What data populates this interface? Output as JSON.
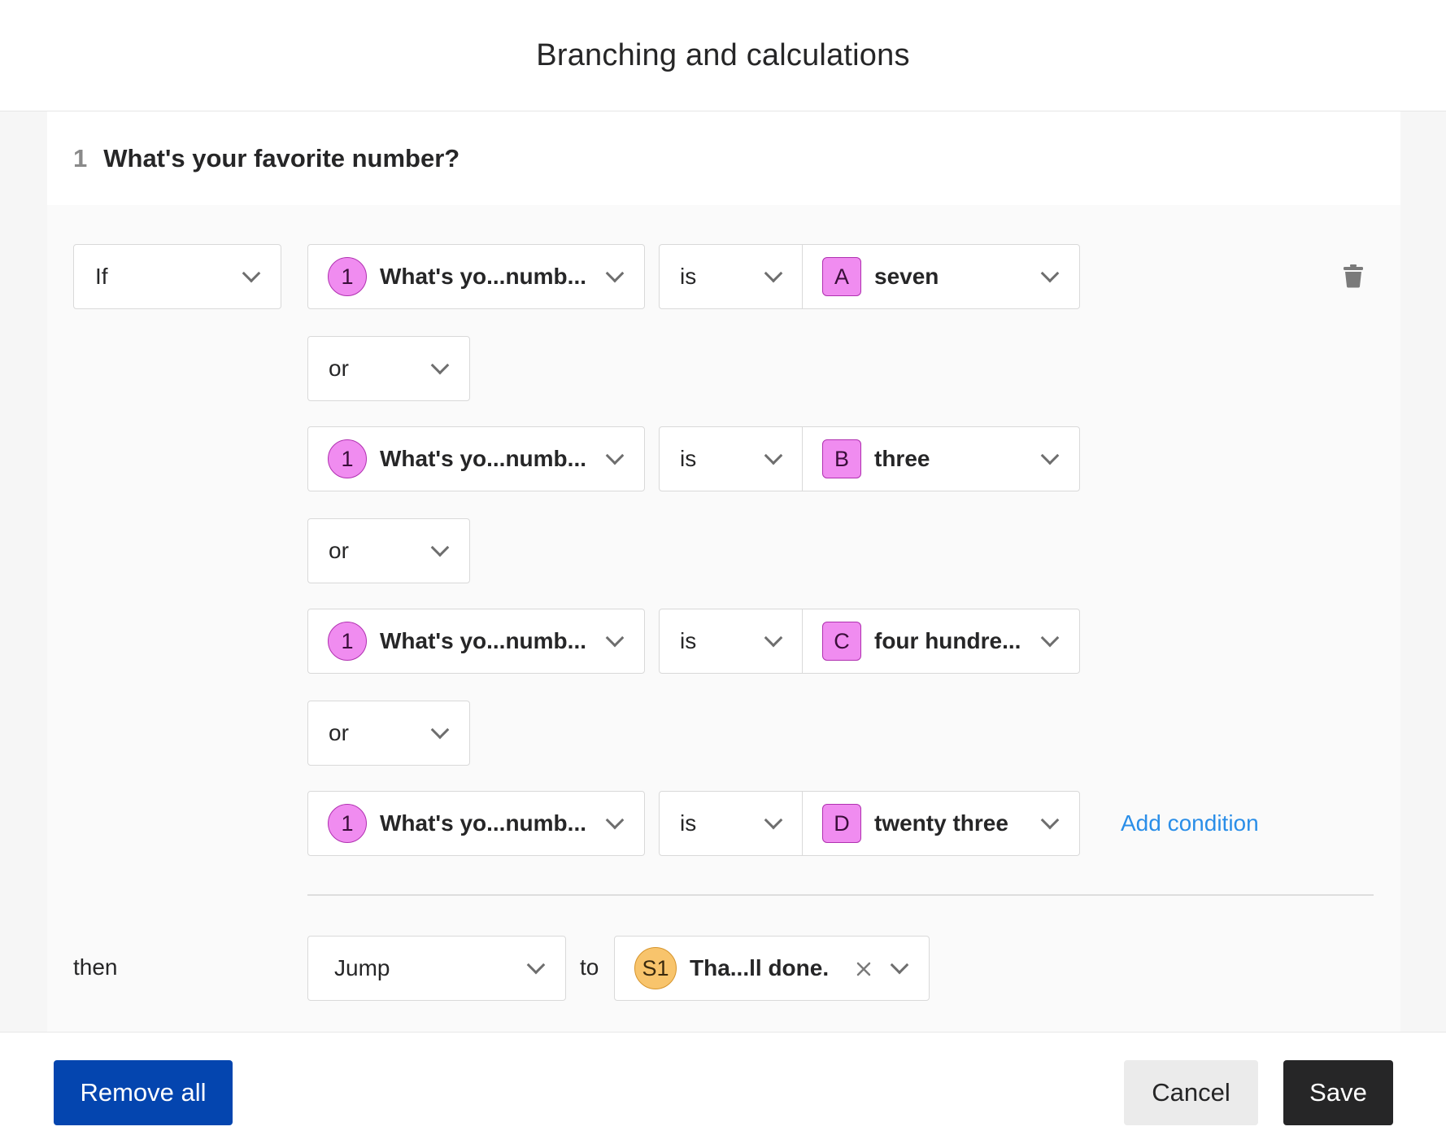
{
  "dialog": {
    "title": "Branching and calculations"
  },
  "question": {
    "number": "1",
    "title": "What's your favorite number?"
  },
  "logic": {
    "if_label": "If",
    "conditions": [
      {
        "q_badge": "1",
        "q_label": "What's yo...numb...",
        "op": "is",
        "v_badge": "A",
        "v_label": "seven"
      },
      {
        "q_badge": "1",
        "q_label": "What's yo...numb...",
        "op": "is",
        "v_badge": "B",
        "v_label": "three"
      },
      {
        "q_badge": "1",
        "q_label": "What's yo...numb...",
        "op": "is",
        "v_badge": "C",
        "v_label": "four hundre..."
      },
      {
        "q_badge": "1",
        "q_label": "What's yo...numb...",
        "op": "is",
        "v_badge": "D",
        "v_label": "twenty three"
      }
    ],
    "connectors": [
      "or",
      "or",
      "or"
    ],
    "add_condition": "Add condition",
    "then_label": "then",
    "action": "Jump",
    "to_label": "to",
    "target_badge": "S1",
    "target_label": "Tha...ll done."
  },
  "footer": {
    "remove_all": "Remove all",
    "cancel": "Cancel",
    "save": "Save"
  },
  "icons": {
    "delete": "trash-icon",
    "clear": "close-icon",
    "dropdown": "chevron-down-icon"
  },
  "colors": {
    "primary": "#0445af",
    "link": "#2a8ee8",
    "choice_badge": "#f08cf0",
    "statement_badge": "#f8c46c",
    "save": "#262627"
  }
}
